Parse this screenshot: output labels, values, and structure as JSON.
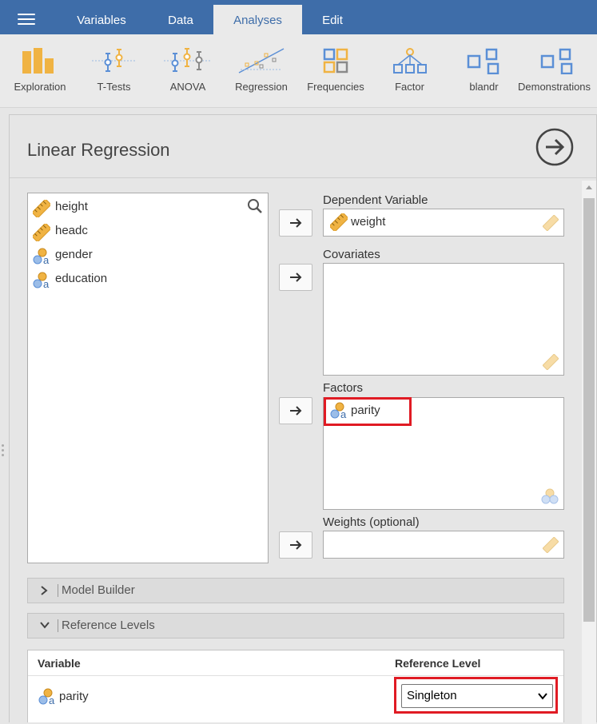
{
  "menu": {
    "tabs": [
      {
        "label": "Variables"
      },
      {
        "label": "Data"
      },
      {
        "label": "Analyses"
      },
      {
        "label": "Edit"
      }
    ]
  },
  "ribbon": {
    "items": [
      {
        "label": "Exploration",
        "icon": "exploration-icon"
      },
      {
        "label": "T-Tests",
        "icon": "t-tests-icon"
      },
      {
        "label": "ANOVA",
        "icon": "anova-icon"
      },
      {
        "label": "Regression",
        "icon": "regression-icon"
      },
      {
        "label": "Frequencies",
        "icon": "frequencies-icon"
      },
      {
        "label": "Factor",
        "icon": "factor-icon"
      },
      {
        "label": "blandr",
        "icon": "module-icon"
      },
      {
        "label": "Demonstrations",
        "icon": "module-icon"
      }
    ]
  },
  "analysis": {
    "title": "Linear Regression"
  },
  "variables": [
    {
      "name": "height",
      "type": "continuous"
    },
    {
      "name": "headc",
      "type": "continuous"
    },
    {
      "name": "gender",
      "type": "nominal"
    },
    {
      "name": "education",
      "type": "nominal"
    }
  ],
  "targets": {
    "dependent": {
      "label": "Dependent Variable",
      "value": "weight"
    },
    "covariates": {
      "label": "Covariates"
    },
    "factors": {
      "label": "Factors",
      "items": [
        "parity"
      ]
    },
    "weights": {
      "label": "Weights (optional)"
    }
  },
  "sections": {
    "model_builder": "Model Builder",
    "reference_levels": "Reference Levels"
  },
  "reference_levels": {
    "col_variable": "Variable",
    "col_level": "Reference Level",
    "rows": [
      {
        "variable": "parity",
        "level": "Singleton"
      }
    ]
  },
  "colors": {
    "menu_bg": "#3e6da9",
    "ribbon_orange": "#f0b343",
    "ribbon_blue": "#5b8fd6",
    "highlight": "#e01b24"
  }
}
